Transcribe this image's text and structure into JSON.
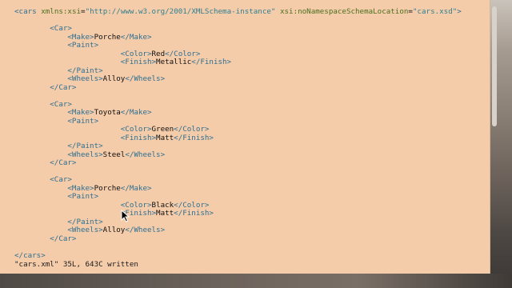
{
  "file": {
    "name": "cars.xml"
  },
  "editor": {
    "lines": [
      {
        "indent": "",
        "parts": [
          {
            "t": "tag",
            "v": "<cars"
          },
          {
            "t": "txt",
            "v": " "
          },
          {
            "t": "attr",
            "v": "xmlns:xsi"
          },
          {
            "t": "txt",
            "v": "="
          },
          {
            "t": "str",
            "v": "\"http://www.w3.org/2001/XMLSchema-instance\""
          },
          {
            "t": "txt",
            "v": " "
          },
          {
            "t": "attr",
            "v": "xsi:noNamespaceSchemaLocation"
          },
          {
            "t": "txt",
            "v": "="
          },
          {
            "t": "str",
            "v": "\"cars.xsd\""
          },
          {
            "t": "tag",
            "v": ">"
          }
        ]
      },
      {
        "indent": "",
        "parts": []
      },
      {
        "indent": "        ",
        "parts": [
          {
            "t": "tag",
            "v": "<Car>"
          }
        ]
      },
      {
        "indent": "            ",
        "parts": [
          {
            "t": "tag",
            "v": "<Make>"
          },
          {
            "t": "txt",
            "v": "Porche"
          },
          {
            "t": "tag",
            "v": "</Make>"
          }
        ]
      },
      {
        "indent": "            ",
        "parts": [
          {
            "t": "tag",
            "v": "<Paint>"
          }
        ]
      },
      {
        "indent": "                        ",
        "parts": [
          {
            "t": "tag",
            "v": "<Color>"
          },
          {
            "t": "txt",
            "v": "Red"
          },
          {
            "t": "tag",
            "v": "</Color>"
          }
        ]
      },
      {
        "indent": "                        ",
        "parts": [
          {
            "t": "tag",
            "v": "<Finish>"
          },
          {
            "t": "txt",
            "v": "Metallic"
          },
          {
            "t": "tag",
            "v": "</Finish>"
          }
        ]
      },
      {
        "indent": "            ",
        "parts": [
          {
            "t": "tag",
            "v": "</Paint>"
          }
        ]
      },
      {
        "indent": "            ",
        "parts": [
          {
            "t": "tag",
            "v": "<Wheels>"
          },
          {
            "t": "txt",
            "v": "Alloy"
          },
          {
            "t": "tag",
            "v": "</Wheels>"
          }
        ]
      },
      {
        "indent": "        ",
        "parts": [
          {
            "t": "tag",
            "v": "</Car>"
          }
        ]
      },
      {
        "indent": "",
        "parts": []
      },
      {
        "indent": "        ",
        "parts": [
          {
            "t": "tag",
            "v": "<Car>"
          }
        ]
      },
      {
        "indent": "            ",
        "parts": [
          {
            "t": "tag",
            "v": "<Make>"
          },
          {
            "t": "txt",
            "v": "Toyota"
          },
          {
            "t": "tag",
            "v": "</Make>"
          }
        ]
      },
      {
        "indent": "            ",
        "parts": [
          {
            "t": "tag",
            "v": "<Paint>"
          }
        ]
      },
      {
        "indent": "                        ",
        "parts": [
          {
            "t": "tag",
            "v": "<Color>"
          },
          {
            "t": "txt",
            "v": "Green"
          },
          {
            "t": "tag",
            "v": "</Color>"
          }
        ]
      },
      {
        "indent": "                        ",
        "parts": [
          {
            "t": "tag",
            "v": "<Finish>"
          },
          {
            "t": "txt",
            "v": "Matt"
          },
          {
            "t": "tag",
            "v": "</Finish>"
          }
        ]
      },
      {
        "indent": "            ",
        "parts": [
          {
            "t": "tag",
            "v": "</Paint>"
          }
        ]
      },
      {
        "indent": "            ",
        "parts": [
          {
            "t": "tag",
            "v": "<Wheels>"
          },
          {
            "t": "txt",
            "v": "Steel"
          },
          {
            "t": "tag",
            "v": "</Wheels>"
          }
        ]
      },
      {
        "indent": "        ",
        "parts": [
          {
            "t": "tag",
            "v": "</Car>"
          }
        ]
      },
      {
        "indent": "",
        "parts": []
      },
      {
        "indent": "        ",
        "parts": [
          {
            "t": "tag",
            "v": "<Car>"
          }
        ]
      },
      {
        "indent": "            ",
        "parts": [
          {
            "t": "tag",
            "v": "<Make>"
          },
          {
            "t": "txt",
            "v": "Porche"
          },
          {
            "t": "tag",
            "v": "</Make>"
          }
        ]
      },
      {
        "indent": "            ",
        "parts": [
          {
            "t": "tag",
            "v": "<Paint>"
          }
        ]
      },
      {
        "indent": "                        ",
        "parts": [
          {
            "t": "tag",
            "v": "<Color>"
          },
          {
            "t": "txt",
            "v": "Black"
          },
          {
            "t": "tag",
            "v": "</Color>"
          }
        ]
      },
      {
        "indent": "                        ",
        "parts": [
          {
            "t": "tag",
            "v": "<Finish>"
          },
          {
            "t": "txt",
            "v": "Matt"
          },
          {
            "t": "tag",
            "v": "</Finish>"
          }
        ]
      },
      {
        "indent": "            ",
        "parts": [
          {
            "t": "tag",
            "v": "</Paint>"
          }
        ]
      },
      {
        "indent": "            ",
        "parts": [
          {
            "t": "tag",
            "v": "<Wheels>"
          },
          {
            "t": "txt",
            "v": "Alloy"
          },
          {
            "t": "tag",
            "v": "</Wheels>"
          }
        ]
      },
      {
        "indent": "        ",
        "parts": [
          {
            "t": "tag",
            "v": "</Car>"
          }
        ]
      },
      {
        "indent": "",
        "parts": []
      },
      {
        "indent": "",
        "parts": [
          {
            "t": "tag",
            "v": "</cars>"
          }
        ]
      }
    ]
  },
  "status": {
    "message": "\"cars.xml\" 35L, 643C written"
  },
  "colors": {
    "editor_bg": "#f5ccaa",
    "tag": "#2d6f91",
    "attribute": "#4b6f1f",
    "string": "#2f7f90",
    "text": "#111111"
  },
  "icons": {
    "cursor": "mouse-pointer-icon"
  }
}
